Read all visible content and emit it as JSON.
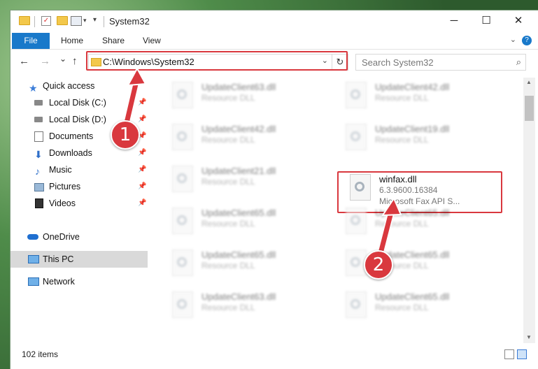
{
  "window": {
    "title": "System32",
    "min_label": "─",
    "max_label": "☐",
    "close_label": "✕"
  },
  "ribbon": {
    "tabs": [
      "File",
      "Home",
      "Share",
      "View"
    ],
    "help_label": "?"
  },
  "nav": {
    "back": "←",
    "forward": "→",
    "recent": "⌄",
    "up": "↑",
    "address": "C:\\Windows\\System32",
    "dropdown": "⌄",
    "refresh": "↻",
    "search_placeholder": "Search System32",
    "search_icon": "⌕"
  },
  "sidebar": {
    "items": [
      {
        "label": "Quick access",
        "icon": "star-icon"
      },
      {
        "label": "Local Disk (C:)",
        "icon": "drive-icon",
        "pinned": true
      },
      {
        "label": "Local Disk (D:)",
        "icon": "drive-icon",
        "pinned": true
      },
      {
        "label": "Documents",
        "icon": "documents-icon",
        "pinned": true
      },
      {
        "label": "Downloads",
        "icon": "downloads-icon",
        "pinned": true
      },
      {
        "label": "Music",
        "icon": "music-icon",
        "pinned": true
      },
      {
        "label": "Pictures",
        "icon": "pictures-icon",
        "pinned": true
      },
      {
        "label": "Videos",
        "icon": "videos-icon",
        "pinned": true
      },
      {
        "label": "OneDrive",
        "icon": "cloud-icon"
      },
      {
        "label": "This PC",
        "icon": "monitor-icon",
        "selected": true
      },
      {
        "label": "Network",
        "icon": "network-icon"
      }
    ],
    "pin_glyph": "📌"
  },
  "files": [
    {
      "name": "UpdateClient63.dll",
      "type": "Resource DLL"
    },
    {
      "name": "UpdateClient42.dll",
      "type": "Resource DLL"
    },
    {
      "name": "UpdateClient42.dll",
      "type": "Resource DLL"
    },
    {
      "name": "UpdateClient19.dll",
      "type": "Resource DLL"
    },
    {
      "name": "UpdateClient21.dll",
      "type": "Resource DLL"
    },
    {
      "name": "winfax.dll",
      "version": "6.3.9600.16384",
      "desc": "Microsoft Fax API S..."
    },
    {
      "name": "UpdateClient65.dll",
      "type": "Resource DLL"
    },
    {
      "name": "UpdateClient65.dll",
      "type": "Resource DLL"
    },
    {
      "name": "UpdateClient65.dll",
      "type": "Resource DLL"
    },
    {
      "name": "UpdateClient65.dll",
      "type": "Resource DLL"
    },
    {
      "name": "UpdateClient63.dll",
      "type": "Resource DLL"
    },
    {
      "name": "UpdateClient65.dll",
      "type": "Resource DLL"
    }
  ],
  "status": {
    "count": "102 items"
  },
  "callouts": {
    "one": "1",
    "two": "2"
  },
  "colors": {
    "accent": "#1979ca",
    "highlight": "#d9383e"
  }
}
